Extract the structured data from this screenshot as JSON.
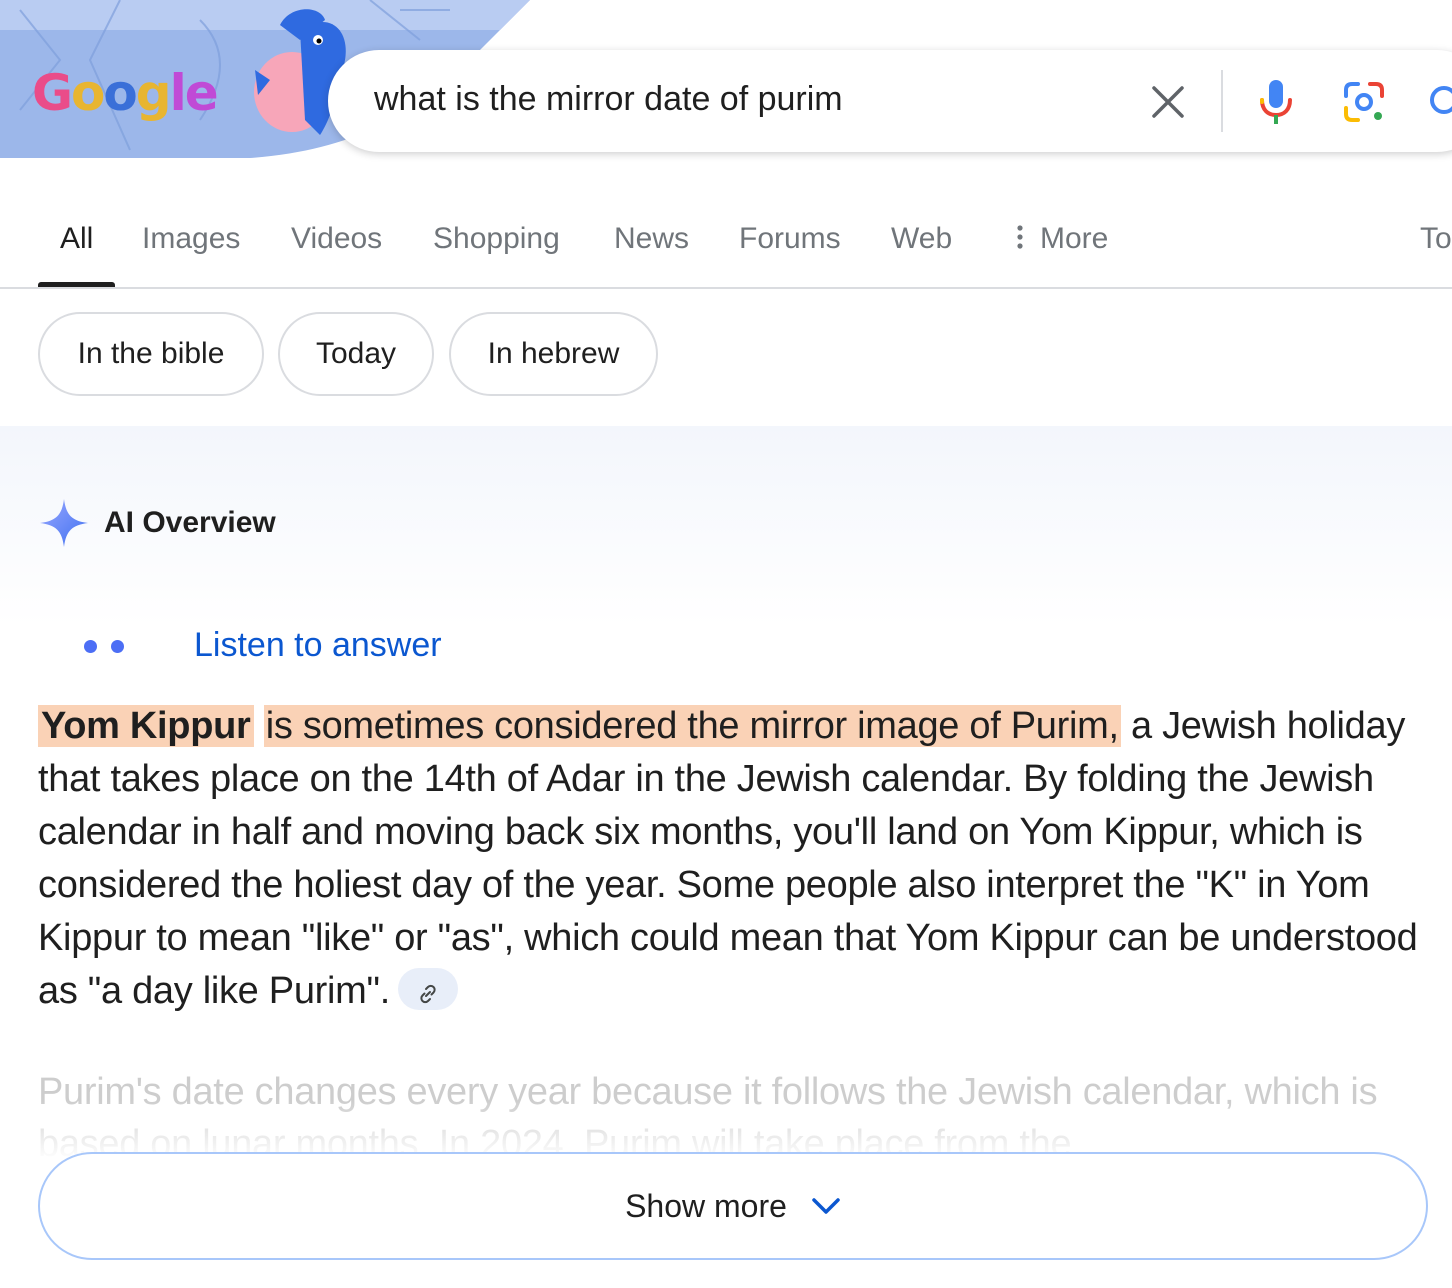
{
  "logo": {
    "text": "Google",
    "letters": [
      "G",
      "o",
      "o",
      "g",
      "l",
      "e"
    ]
  },
  "search": {
    "query": "what is the mirror date of purim",
    "icons": [
      "close-icon",
      "microphone-icon",
      "google-lens-icon",
      "search-icon"
    ]
  },
  "tabs": [
    {
      "label": "All"
    },
    {
      "label": "Images"
    },
    {
      "label": "Videos"
    },
    {
      "label": "Shopping"
    },
    {
      "label": "News"
    },
    {
      "label": "Forums"
    },
    {
      "label": "Web"
    },
    {
      "label": "More"
    },
    {
      "label": "To"
    }
  ],
  "chips": [
    {
      "label": "In the bible"
    },
    {
      "label": "Today"
    },
    {
      "label": "In hebrew"
    }
  ],
  "ai_overview": {
    "title": "AI Overview",
    "listen_label": "Listen to answer",
    "answer_highlight_bold": "Yom Kippur",
    "answer_highlight_rest": "is sometimes considered the mirror image of Purim,",
    "answer_rest": "a Jewish holiday that takes place on the 14th of Adar in the Jewish calendar. By folding the Jewish calendar in half and moving back six months, you'll land on Yom Kippur, which is considered the holiest day of the year. Some people also interpret the \"K\" in Yom Kippur to mean \"like\" or \"as\", which could mean that Yom Kippur can be understood as \"a day like Purim\".",
    "faded_text": "Purim's date changes every year because it follows the Jewish calendar, which is based on lunar months. In 2024, Purim will take place from the",
    "show_more_label": "Show more"
  },
  "colors": {
    "highlight": "#fad2b6",
    "link_blue": "#0b57d0",
    "tab_active": "#1f1f1f",
    "tab_inactive": "#70757a",
    "show_more_border": "#a8c7fa"
  }
}
